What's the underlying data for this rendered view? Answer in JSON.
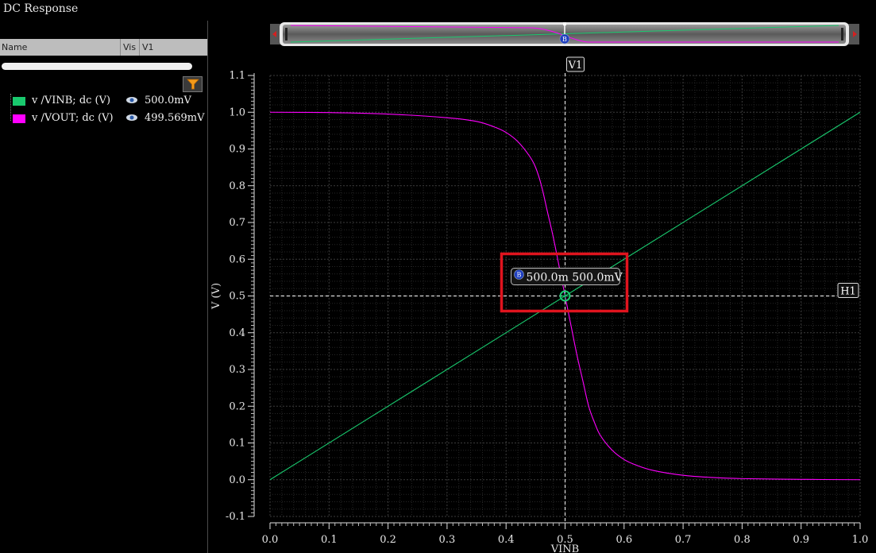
{
  "window": {
    "title": "DC Response"
  },
  "table_header": {
    "name": "Name",
    "vis": "Vis",
    "v1": "V1"
  },
  "signals": [
    {
      "name": "v /VINB; dc (V)",
      "value": "500.0mV",
      "color": "#19c96e",
      "icon": "eye-icon"
    },
    {
      "name": "v /VOUT; dc (V)",
      "value": "499.569mV",
      "color": "#ff00ff",
      "icon": "eye-icon"
    }
  ],
  "overview": {
    "marker_label": "B"
  },
  "marker": {
    "label": "B",
    "readout": "500.0m 500.0mV"
  },
  "cursors": {
    "vertical": "V1",
    "horizontal": "H1"
  },
  "colors": {
    "vinb": "#19c96e",
    "vout": "#ff00ff",
    "highlight": "#e0141e",
    "background": "#000000"
  },
  "chart_data": {
    "type": "line",
    "xlabel": "VINB",
    "ylabel": "V (V)",
    "xlim": [
      0.0,
      1.0
    ],
    "ylim": [
      -0.1,
      1.1
    ],
    "x_ticks": [
      "0.0",
      "0.1",
      "0.2",
      "0.3",
      "0.4",
      "0.5",
      "0.6",
      "0.7",
      "0.8",
      "0.9",
      "1.0"
    ],
    "y_ticks": [
      "-0.1",
      "0.0",
      "0.1",
      "0.2",
      "0.3",
      "0.4",
      "0.5",
      "0.6",
      "0.7",
      "0.8",
      "0.9",
      "1.0",
      "1.1"
    ],
    "grid": true,
    "cursor_x": 0.5,
    "cursor_y": 0.5,
    "series": [
      {
        "name": "v /VINB; dc (V)",
        "color": "#19c96e",
        "x": [
          0.0,
          1.0
        ],
        "y": [
          0.0,
          1.0
        ]
      },
      {
        "name": "v /VOUT; dc (V)",
        "color": "#ff00ff",
        "x": [
          0.0,
          0.1,
          0.2,
          0.3,
          0.35,
          0.38,
          0.4,
          0.42,
          0.44,
          0.45,
          0.46,
          0.47,
          0.48,
          0.49,
          0.5,
          0.51,
          0.52,
          0.53,
          0.54,
          0.55,
          0.56,
          0.58,
          0.6,
          0.62,
          0.65,
          0.7,
          0.75,
          0.8,
          0.9,
          1.0
        ],
        "y": [
          1.0,
          0.999,
          0.995,
          0.985,
          0.975,
          0.96,
          0.945,
          0.92,
          0.88,
          0.85,
          0.8,
          0.73,
          0.66,
          0.58,
          0.5,
          0.42,
          0.34,
          0.27,
          0.2,
          0.155,
          0.12,
          0.08,
          0.055,
          0.04,
          0.025,
          0.012,
          0.006,
          0.003,
          0.001,
          0.0
        ]
      }
    ]
  }
}
